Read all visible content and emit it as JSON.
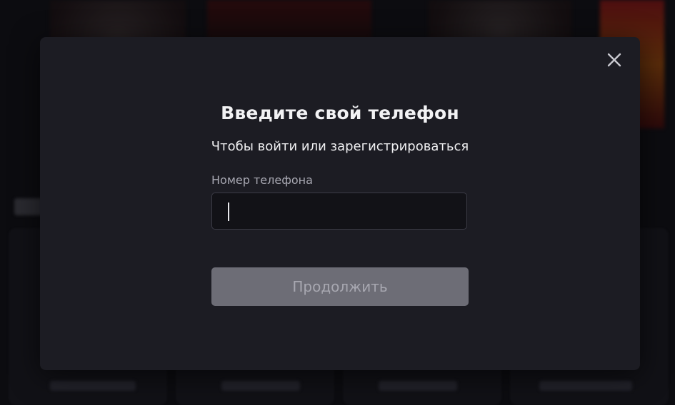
{
  "modal": {
    "title": "Введите свой телефон",
    "subtitle": "Чтобы войти или зарегистрироваться",
    "phone_label": "Номер телефона",
    "phone_value": "",
    "continue_label": "Продолжить",
    "close_icon": "close-icon"
  },
  "colors": {
    "modal_bg": "#1c1c23",
    "input_bg": "#121217",
    "button_disabled_bg": "#6d6d76",
    "button_disabled_text": "#a7a7b0"
  }
}
